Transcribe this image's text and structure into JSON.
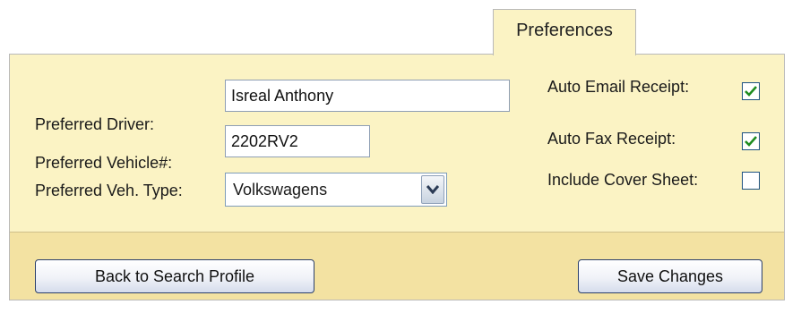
{
  "tab": {
    "label": "Preferences"
  },
  "form": {
    "driver_label": "Preferred Driver:",
    "driver_value": "Isreal Anthony",
    "vehicle_label": "Preferred Vehicle#:",
    "vehicle_value": "2202RV2",
    "veh_type_label": "Preferred Veh. Type:",
    "veh_type_value": "Volkswagens"
  },
  "options": {
    "auto_email_label": "Auto Email Receipt:",
    "auto_email_checked": true,
    "auto_fax_label": "Auto Fax Receipt:",
    "auto_fax_checked": true,
    "cover_sheet_label": "Include Cover Sheet:",
    "cover_sheet_checked": false
  },
  "buttons": {
    "back_label": "Back to Search Profile",
    "save_label": "Save Changes"
  },
  "colors": {
    "panel_bg": "#fbf3c4",
    "footer_bg": "#f3e2a2",
    "check_color": "#1e8c1e"
  },
  "icons": {
    "dropdown": "chevron-down-icon",
    "check": "checkmark-icon"
  }
}
